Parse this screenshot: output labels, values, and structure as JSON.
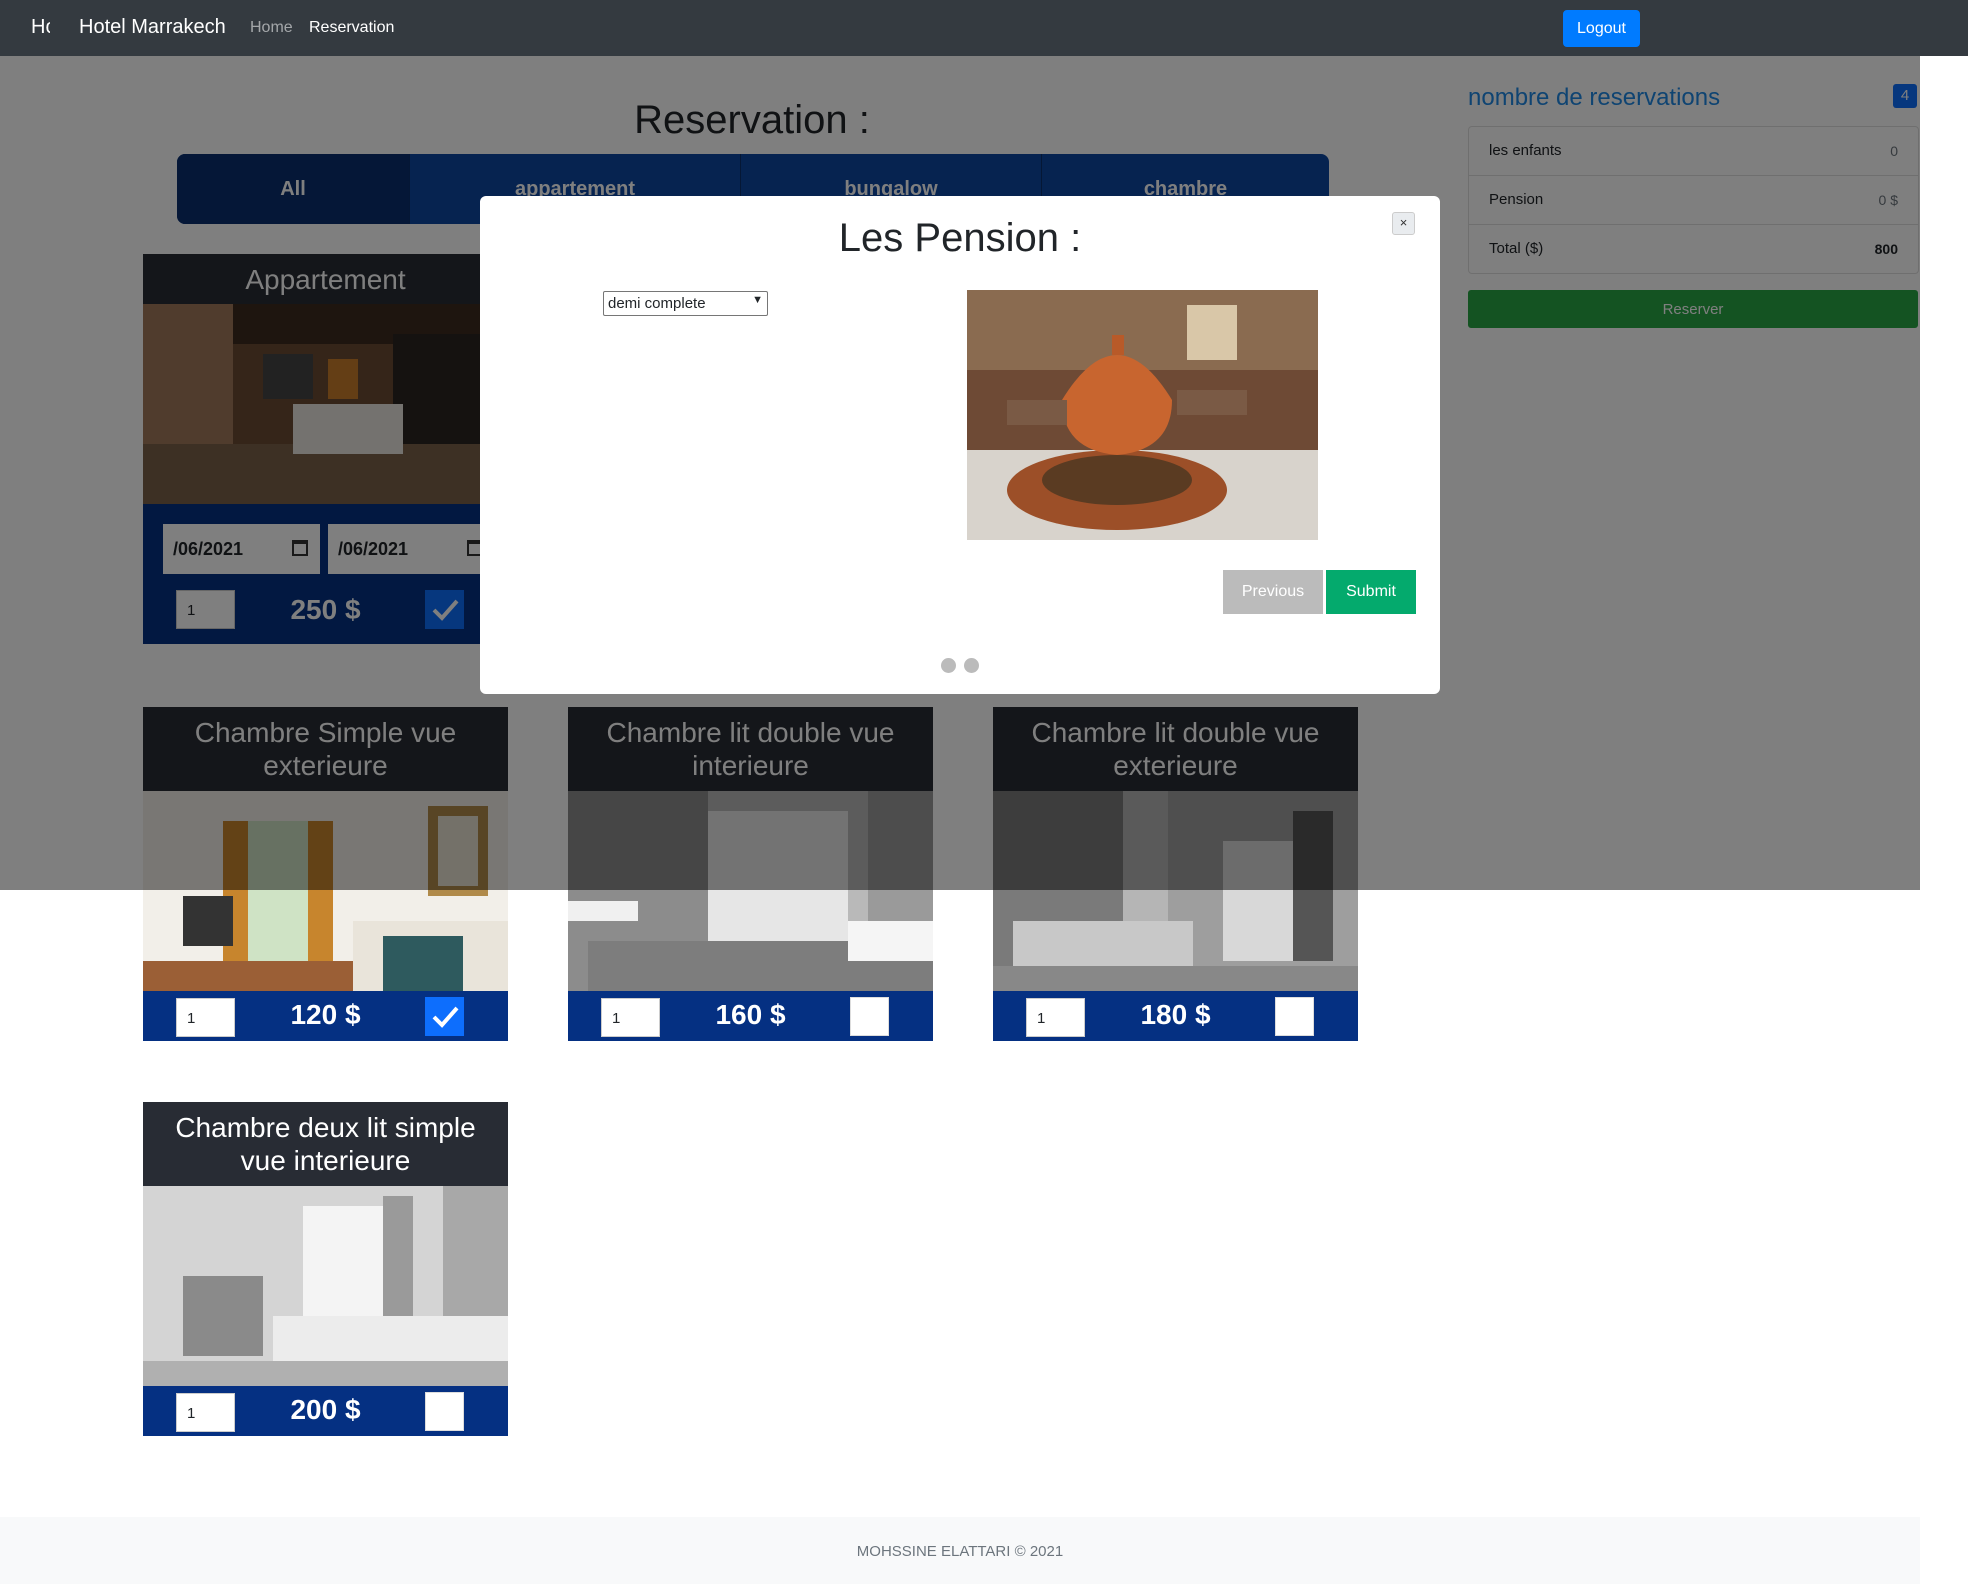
{
  "navbar": {
    "logo": "Hotel Marrakech",
    "brand": "Hotel Marrakech",
    "links": [
      "Home",
      "Reservation"
    ],
    "logout_label": "Logout"
  },
  "page": {
    "title": "Reservation :",
    "tabs": [
      "All",
      "appartement",
      "bungalow",
      "chambre"
    ]
  },
  "rooms": [
    {
      "name": "Appartement",
      "from_date": "/06/2021",
      "to_date": "/06/2021",
      "qty": "1",
      "price": "250 $",
      "selected": true
    },
    {
      "name": "Chambre Simple vue exterieure",
      "qty": "1",
      "price": "120 $",
      "selected": true
    },
    {
      "name": "Chambre lit double vue interieure",
      "qty": "1",
      "price": "160 $",
      "selected": false
    },
    {
      "name": "Chambre lit double vue exterieure",
      "qty": "1",
      "price": "180 $",
      "selected": false
    },
    {
      "name": "Chambre deux lit simple vue interieure",
      "qty": "1",
      "price": "200 $",
      "selected": false
    }
  ],
  "sidebar": {
    "title": "nombre de reservations",
    "count": "4",
    "items": [
      {
        "label": "les enfants",
        "value": "0"
      },
      {
        "label": "Pension",
        "value": "0 $"
      },
      {
        "label": "Total ($)",
        "value": "800"
      }
    ],
    "reserve_label": "Reserver"
  },
  "modal": {
    "title": "Les Pension :",
    "close": "×",
    "select_value": "demi complete",
    "previous_label": "Previous",
    "submit_label": "Submit"
  },
  "footer": {
    "text": "MOHSSINE ELATTARI © 2021"
  },
  "colors": {
    "navbar": "#343a40",
    "primary": "#007bff",
    "card_footer": "#053082",
    "success": "#28a745",
    "submit": "#04aa6d",
    "sidebar_title": "#1e88e5"
  }
}
